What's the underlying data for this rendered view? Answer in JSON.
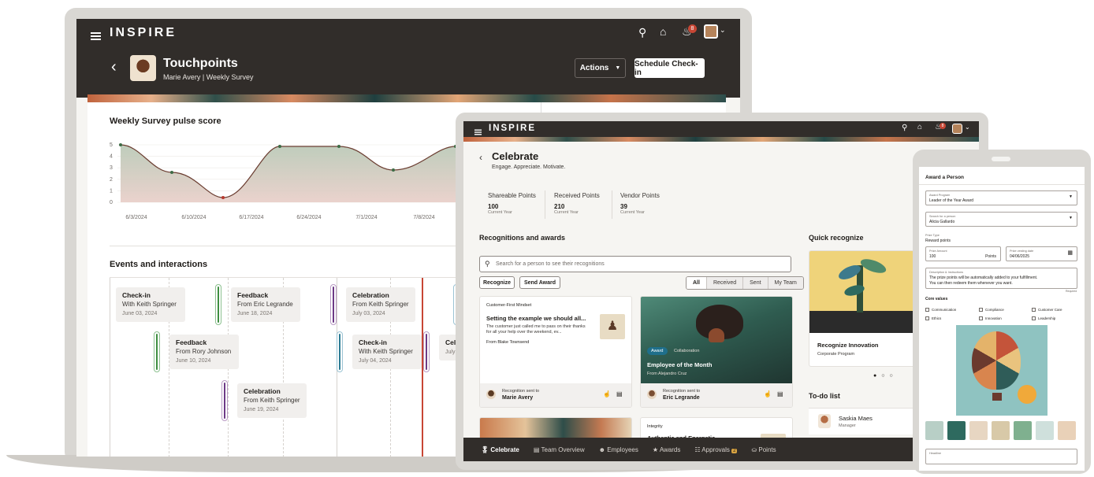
{
  "laptop": {
    "app_name": "INSPIRE",
    "header": {
      "title": "Touchpoints",
      "subtitle": "Marie Avery | Weekly Survey",
      "actions_label": "Actions",
      "schedule_label": "Schedule Check-in"
    },
    "notif_count": "8",
    "pulse": {
      "title": "Weekly Survey pulse score",
      "y_ticks": [
        "5",
        "4",
        "3",
        "2",
        "1",
        "0"
      ],
      "x_ticks": [
        "6/3/2024",
        "6/10/2024",
        "6/17/2024",
        "6/24/2024",
        "7/1/2024",
        "7/8/2024"
      ]
    },
    "events": {
      "title": "Events and interactions",
      "items": [
        {
          "title": "Check-in",
          "line": "With Keith Springer",
          "date": "June 03, 2024"
        },
        {
          "title": "Feedback",
          "line": "From Eric Legrande",
          "date": "June 18, 2024"
        },
        {
          "title": "Celebration",
          "line": "From Keith Springer",
          "date": "July 03, 2024"
        },
        {
          "title": "Feedback",
          "line": "From Rory Johnson",
          "date": "June 10, 2024"
        },
        {
          "title": "Check-in",
          "line": "With Keith Springer",
          "date": "July 04, 2024"
        },
        {
          "title": "Cele",
          "line": "",
          "date": "July"
        },
        {
          "title": "Celebration",
          "line": "From Keith Springer",
          "date": "June 19, 2024"
        }
      ]
    }
  },
  "tablet": {
    "app_name": "INSPIRE",
    "notif_count": "8",
    "page_title": "Celebrate",
    "page_subtitle": "Engage. Appreciate. Motivate.",
    "kpis": [
      {
        "label": "Shareable Points",
        "value": "100",
        "sub": "Current Year"
      },
      {
        "label": "Received Points",
        "value": "210",
        "sub": "Current Year"
      },
      {
        "label": "Vendor Points",
        "value": "39",
        "sub": "Current Year"
      }
    ],
    "recognitions": {
      "title": "Recognitions and awards",
      "search_placeholder": "Search for a person to see their recognitions",
      "btn_recognize": "Recognize",
      "btn_send_award": "Send Award",
      "filters": [
        "All",
        "Received",
        "Sent",
        "My Team"
      ],
      "card1": {
        "tag": "Customer-First Mindset",
        "headline": "Setting the example we should all...",
        "body": "The customer just called me to pass on their thanks for all your help over the weekend, ev...",
        "from": "From Blake Townsend",
        "footer_label": "Recognition sent to",
        "footer_name": "Marie Avery"
      },
      "card2": {
        "chip1": "Award",
        "chip2": "Collaboration",
        "headline": "Employee of the Month",
        "from": "From Alejandro Cruz",
        "footer_label": "Recognition sent to",
        "footer_name": "Eric Legrande"
      },
      "card4": {
        "tag": "Integrity",
        "headline": "Authentic and Energetic"
      }
    },
    "quick": {
      "title": "Quick recognize",
      "card_title": "Recognize Innovation",
      "card_sub": "Corporate Program"
    },
    "todo": {
      "title": "To-do list",
      "name": "Saskia Maes",
      "role": "Manager"
    },
    "nav": [
      {
        "label": "Celebrate"
      },
      {
        "label": "Team Overview"
      },
      {
        "label": "Employees"
      },
      {
        "label": "Awards"
      },
      {
        "label": "Approvals",
        "badge": "2"
      },
      {
        "label": "Points"
      }
    ]
  },
  "phone": {
    "title": "Award a Person",
    "program_label": "Award Program",
    "program_value": "Leader of the Year Award",
    "person_label": "Search for a person",
    "person_value": "Alicia Gallardo",
    "prize_type_label": "Prize Type",
    "prize_type_value": "Reward points",
    "amount_label": "Prize Amount",
    "amount_value": "100",
    "amount_unit": "Points",
    "date_label": "Prize vesting date",
    "date_value": "04/06/2025",
    "desc_label": "Description & Instructions",
    "desc_line1": "The prize points will be automatically added to your fulfillment.",
    "desc_line2": "You can then redeem them whenever you want.",
    "required": "Required",
    "core_values_label": "Core values",
    "core_values": [
      "Communication",
      "Compliance",
      "Customer Care",
      "Ethics",
      "Innovation",
      "Leadership"
    ],
    "headline_label": "Headline"
  }
}
